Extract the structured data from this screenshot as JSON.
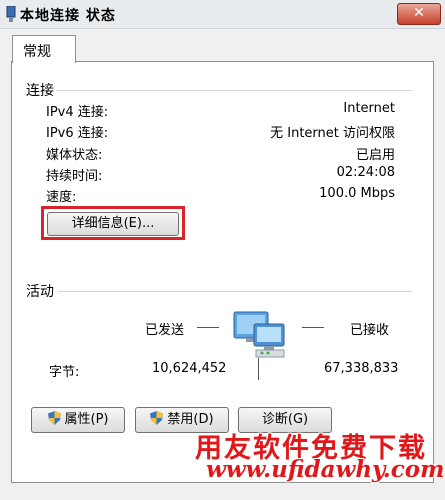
{
  "window": {
    "title": "本地连接 状态",
    "close_label": "✕"
  },
  "tabs": [
    {
      "label": "常规",
      "selected": true
    }
  ],
  "connection": {
    "heading": "连接",
    "rows": [
      {
        "label": "IPv4 连接:",
        "value": "Internet"
      },
      {
        "label": "IPv6 连接:",
        "value": "无 Internet 访问权限"
      },
      {
        "label": "媒体状态:",
        "value": "已启用"
      },
      {
        "label": "持续时间:",
        "value": "02:24:08"
      },
      {
        "label": "速度:",
        "value": "100.0 Mbps"
      }
    ],
    "details_button": "详细信息(E)..."
  },
  "activity": {
    "heading": "活动",
    "sent_label": "已发送",
    "received_label": "已接收",
    "bytes_label": "字节:",
    "bytes_sent": "10,624,452",
    "bytes_received": "67,338,833"
  },
  "buttons": {
    "properties": "属性(P)",
    "disable": "禁用(D)",
    "diagnose": "诊断(G)"
  },
  "watermark": {
    "line1": "用友软件免费下载",
    "line2": "www.ufidawhy.com"
  },
  "colors": {
    "highlight_frame": "#d6262b",
    "watermark": "#e0181b"
  },
  "icons": {
    "title": "network-adapter-icon",
    "network": "network-computers-icon",
    "shield": "uac-shield-icon"
  }
}
